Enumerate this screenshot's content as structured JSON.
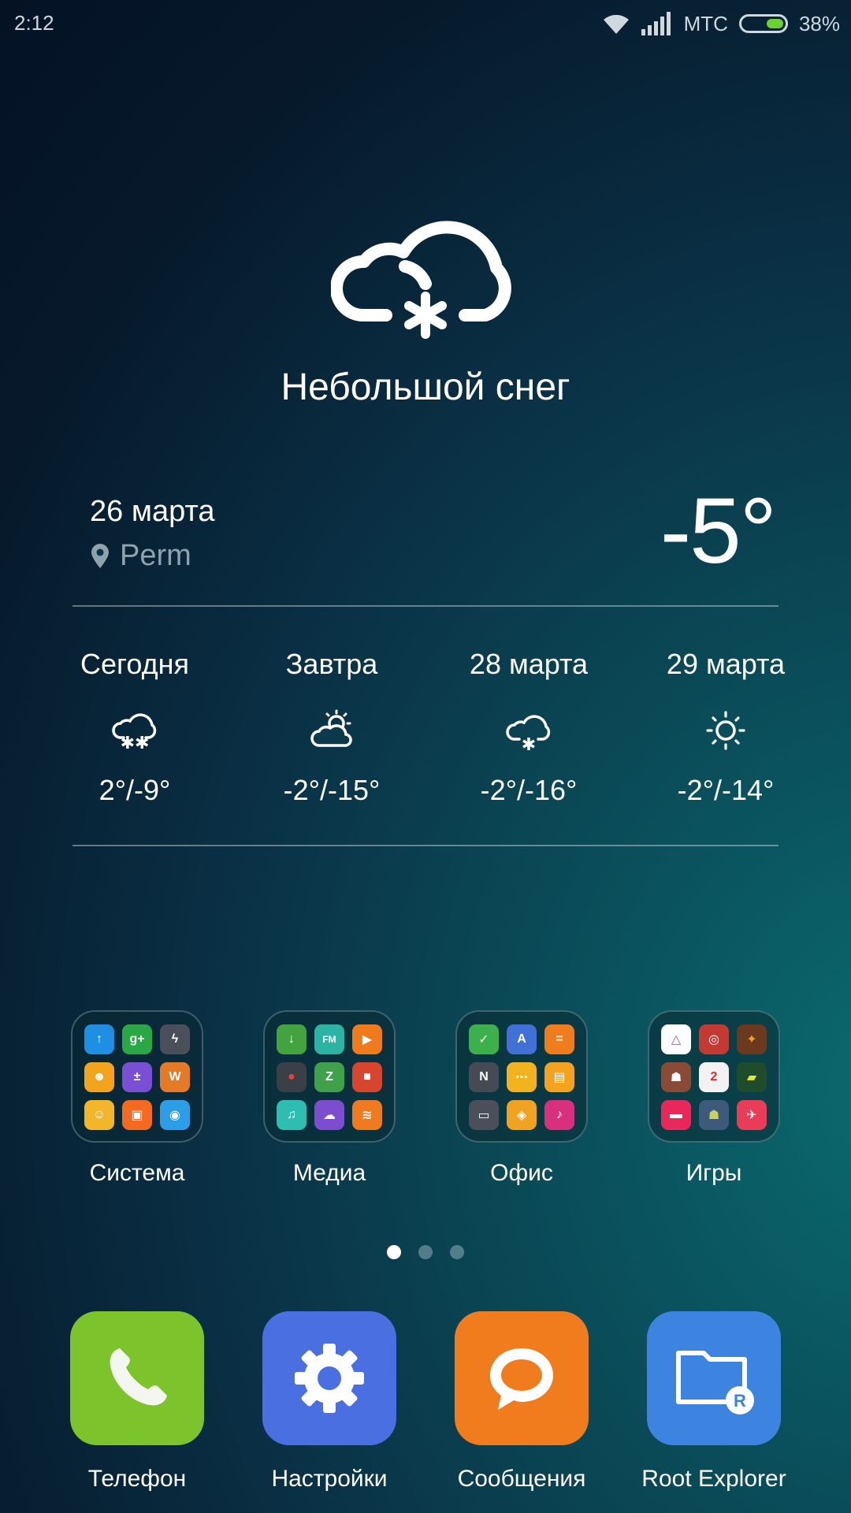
{
  "status": {
    "time": "2:12",
    "carrier": "МТС",
    "battery": "38%",
    "battery_level": 0.38
  },
  "weather": {
    "condition": "Небольшой снег",
    "date": "26 марта",
    "location": "Perm",
    "temperature": "-5°",
    "forecast": [
      {
        "day": "Сегодня",
        "temp": "2°/-9°",
        "icon": "snow-cloud-icon"
      },
      {
        "day": "Завтра",
        "temp": "-2°/-15°",
        "icon": "partly-sunny-icon"
      },
      {
        "day": "28 марта",
        "temp": "-2°/-16°",
        "icon": "light-snow-icon"
      },
      {
        "day": "29 марта",
        "temp": "-2°/-14°",
        "icon": "sun-icon"
      }
    ]
  },
  "folders": [
    {
      "label": "Система",
      "apps": [
        {
          "color": "#1e8fe3",
          "glyph": "↑"
        },
        {
          "color": "#2aa846",
          "glyph": "g+"
        },
        {
          "color": "#4a4f5a",
          "glyph": "ϟ"
        },
        {
          "color": "#f2a51c",
          "glyph": "☻"
        },
        {
          "color": "#7b4fd4",
          "glyph": "±"
        },
        {
          "color": "#e57a26",
          "glyph": "W"
        },
        {
          "color": "#f3b52a",
          "glyph": "☺"
        },
        {
          "color": "#f46a21",
          "glyph": "▣"
        },
        {
          "color": "#2c9ee8",
          "glyph": "◉"
        }
      ]
    },
    {
      "label": "Медиа",
      "apps": [
        {
          "color": "#43a33f",
          "glyph": "↓"
        },
        {
          "color": "#2bb3a4",
          "glyph": "FM"
        },
        {
          "color": "#f07b1c",
          "glyph": "▶"
        },
        {
          "color": "#3b3f47",
          "glyph": "●"
        },
        {
          "color": "#3fa14a",
          "glyph": "Z"
        },
        {
          "color": "#d8452f",
          "glyph": "■"
        },
        {
          "color": "#2dbdb1",
          "glyph": "♫"
        },
        {
          "color": "#7d4dd0",
          "glyph": "☁"
        },
        {
          "color": "#ef7a1f",
          "glyph": "≋"
        }
      ]
    },
    {
      "label": "Офис",
      "apps": [
        {
          "color": "#3cb04a",
          "glyph": "✓"
        },
        {
          "color": "#4170d6",
          "glyph": "A"
        },
        {
          "color": "#f07d1d",
          "glyph": "="
        },
        {
          "color": "#454a55",
          "glyph": "N"
        },
        {
          "color": "#f3b31f",
          "glyph": "⋯"
        },
        {
          "color": "#f3a31f",
          "glyph": "▤"
        },
        {
          "color": "#4a4f5a",
          "glyph": "▭"
        },
        {
          "color": "#f0a321",
          "glyph": "◈"
        },
        {
          "color": "#d8307e",
          "glyph": "♪"
        }
      ]
    },
    {
      "label": "Игры",
      "apps": [
        {
          "color": "#ffffff",
          "glyph": "△"
        },
        {
          "color": "#c33a32",
          "glyph": "◎"
        },
        {
          "color": "#6b3a1e",
          "glyph": "✦"
        },
        {
          "color": "#8a4b36",
          "glyph": "☗"
        },
        {
          "color": "#f2f2f2",
          "glyph": "2"
        },
        {
          "color": "#1f4d2c",
          "glyph": "▰"
        },
        {
          "color": "#e8285a",
          "glyph": "▬"
        },
        {
          "color": "#3d5a7a",
          "glyph": "☗"
        },
        {
          "color": "#e83c58",
          "glyph": "✈"
        }
      ]
    }
  ],
  "pages": {
    "count": 3,
    "active": 0
  },
  "dock": [
    {
      "label": "Телефон",
      "color": "#7cc32c"
    },
    {
      "label": "Настройки",
      "color": "#4a6fe0"
    },
    {
      "label": "Сообщения",
      "color": "#f07c1e"
    },
    {
      "label": "Root Explorer",
      "color": "#3d84e0"
    }
  ]
}
